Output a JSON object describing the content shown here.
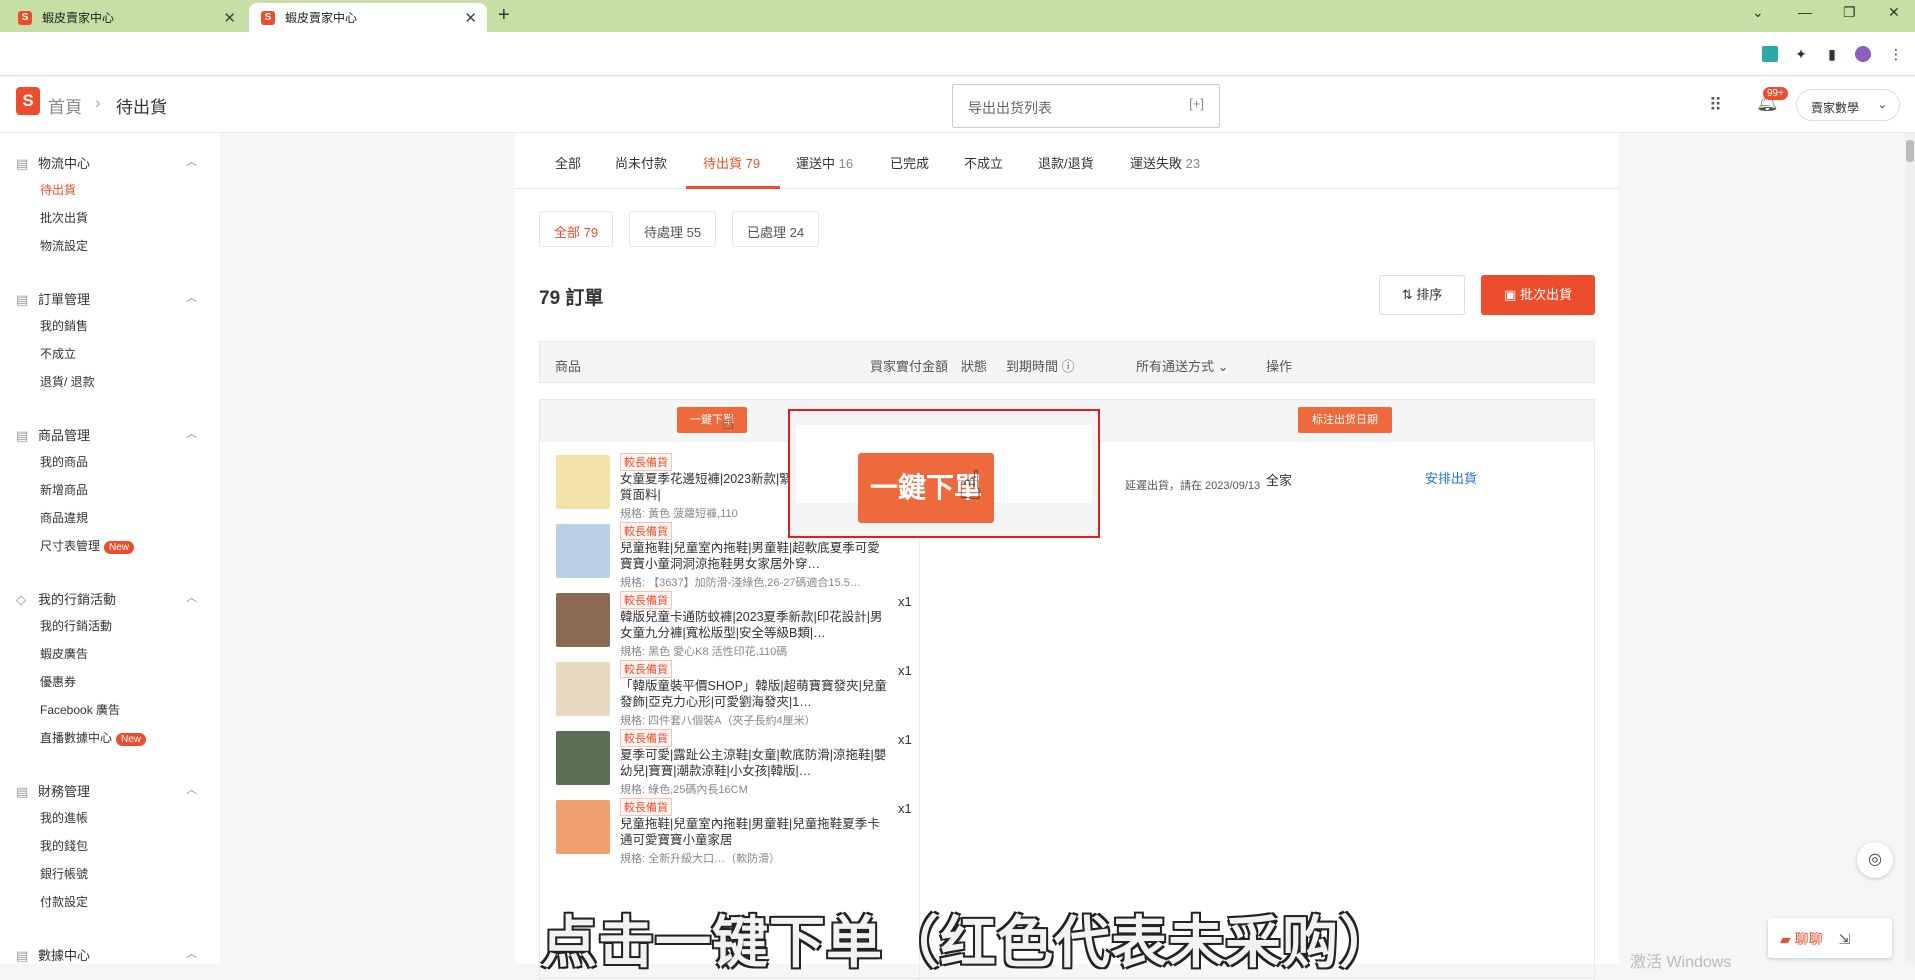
{
  "browser": {
    "tabs": [
      {
        "title": "蝦皮賣家中心"
      },
      {
        "title": "蝦皮賣家中心"
      }
    ],
    "new_tab": "+",
    "win_controls": [
      "⌄",
      "—",
      "❐",
      "✕"
    ]
  },
  "header": {
    "logo": "S",
    "breadcrumb_home": "首頁",
    "breadcrumb_sep": "›",
    "breadcrumb_current": "待出貨",
    "export_label": "导出出货列表",
    "export_plus": "[+]",
    "notif_count": "99+",
    "user_label": "賣家數學"
  },
  "sidebar": {
    "sections": [
      {
        "title": "物流中心",
        "items": [
          "待出貨",
          "批次出貨",
          "物流設定"
        ]
      },
      {
        "title": "訂單管理",
        "items": [
          "我的銷售",
          "不成立",
          "退貨/ 退款"
        ]
      },
      {
        "title": "商品管理",
        "items": [
          "我的商品",
          "新增商品",
          "商品違規",
          "尺寸表管理"
        ]
      },
      {
        "title": "我的行銷活動",
        "items": [
          "我的行銷活動",
          "蝦皮廣告",
          "優惠券",
          "Facebook 廣告",
          "直播數據中心"
        ]
      },
      {
        "title": "財務管理",
        "items": [
          "我的進帳",
          "我的錢包",
          "銀行帳號",
          "付款設定"
        ]
      },
      {
        "title": "數據中心",
        "items": []
      }
    ],
    "new_badge": "New"
  },
  "main": {
    "tabs": [
      {
        "label": "全部",
        "count": ""
      },
      {
        "label": "尚未付款",
        "count": ""
      },
      {
        "label": "待出貨",
        "count": "79"
      },
      {
        "label": "運送中",
        "count": "16"
      },
      {
        "label": "已完成",
        "count": ""
      },
      {
        "label": "不成立",
        "count": ""
      },
      {
        "label": "退款/退貨",
        "count": ""
      },
      {
        "label": "運送失敗",
        "count": "23"
      }
    ],
    "subtabs": [
      {
        "label": "全部",
        "count": "79"
      },
      {
        "label": "待處理",
        "count": "55"
      },
      {
        "label": "已處理",
        "count": "24"
      }
    ],
    "order_count": "79 訂單",
    "sort_label": "排序",
    "batch_label": "批次出貨",
    "columns": {
      "product": "商品",
      "amount": "買家實付金額",
      "status": "狀態",
      "due": "到期時間",
      "shipping": "所有通送方式",
      "action": "操作"
    },
    "order": {
      "onekey_label": "一鍵下單",
      "mark_label": "标注出货日期",
      "status_text": "延遲出貨，請在 2023/09/13",
      "carrier": "全家",
      "arrange": "安排出貨",
      "products": [
        {
          "tag": "較長備貨",
          "name": "女童夏季花邊短褲|2023新款|緊身版型|喇叭褲|棉質面料|",
          "spec": "規格: 黃色 菠蘿短褲,110",
          "qty": "",
          "color": "#f1e2a8"
        },
        {
          "tag": "較長備貨",
          "name": "兒童拖鞋|兒童室內拖鞋|男童鞋|超軟底夏季可愛寶寶小童洞洞涼拖鞋男女家居外穿…",
          "spec": "規格: 【3637】加防滑-淺綠色,26-27碼適合15.5…",
          "qty": "",
          "color": "#b9cfe6"
        },
        {
          "tag": "較長備貨",
          "name": "韓版兒童卡通防蚊褲|2023夏季新款|印花設計|男女童九分褲|寬松版型|安全等級B類|…",
          "spec": "規格: 黑色 愛心K8 活性印花,110碼",
          "qty": "x1",
          "color": "#8a6a52"
        },
        {
          "tag": "較長備貨",
          "name": "「韓版童裝平價SHOP」韓版|超萌寶寶發夾|兒童發飾|亞克力心形|可愛劉海發夾|1…",
          "spec": "規格: 四件套八個裝A（夾子長約4厘米）",
          "qty": "x1",
          "color": "#e9d9c2"
        },
        {
          "tag": "較長備貨",
          "name": "夏季可愛|露趾公主涼鞋|女童|軟底防滑|涼拖鞋|嬰幼兒|寶寶|潮款涼鞋|小女孩|韓版|…",
          "spec": "規格: 綠色,25碼內長16CM",
          "qty": "x1",
          "color": "#5a6e55"
        },
        {
          "tag": "較長備貨",
          "name": "兒童拖鞋|兒童室內拖鞋|男童鞋|兒童拖鞋夏季卡通可愛寶寶小童家居",
          "spec": "規格: 全新升級大口…（軟防滑）",
          "qty": "x1",
          "color": "#f0a070"
        }
      ]
    }
  },
  "overlay": {
    "zoom_button": "一鍵下單",
    "caption": "点击一键下单（红色代表未采购）",
    "chat_label": "聊聊",
    "windows_mark": "激活 Windows"
  }
}
